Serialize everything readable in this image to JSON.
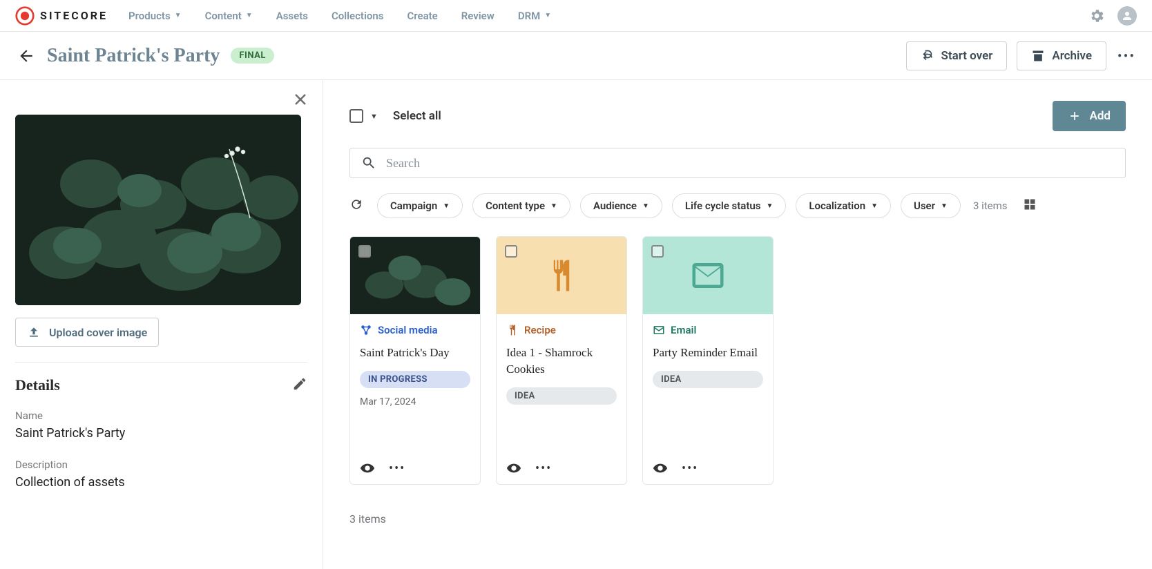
{
  "brand": "SITECORE",
  "nav": {
    "products": "Products",
    "content": "Content",
    "assets": "Assets",
    "collections": "Collections",
    "create": "Create",
    "review": "Review",
    "drm": "DRM"
  },
  "page": {
    "title": "Saint Patrick's Party",
    "status": "FINAL",
    "start_over": "Start over",
    "archive": "Archive"
  },
  "sidepanel": {
    "upload": "Upload cover image",
    "details": "Details",
    "name_label": "Name",
    "name_value": "Saint Patrick's Party",
    "desc_label": "Description",
    "desc_value": "Collection of assets"
  },
  "toolbar": {
    "select_all": "Select all",
    "add": "Add"
  },
  "search": {
    "placeholder": "Search"
  },
  "filters": {
    "campaign": "Campaign",
    "content_type": "Content type",
    "audience": "Audience",
    "lifecycle": "Life cycle status",
    "localization": "Localization",
    "user": "User",
    "count": "3 items"
  },
  "cards": [
    {
      "type": "Social media",
      "title": "Saint Patrick's Day",
      "status": "IN PROGRESS",
      "date": "Mar 17, 2024"
    },
    {
      "type": "Recipe",
      "title": "Idea 1 - Shamrock Cookies",
      "status": "IDEA",
      "date": ""
    },
    {
      "type": "Email",
      "title": "Party Reminder Email",
      "status": "IDEA",
      "date": ""
    }
  ],
  "footer": {
    "count": "3 items"
  }
}
